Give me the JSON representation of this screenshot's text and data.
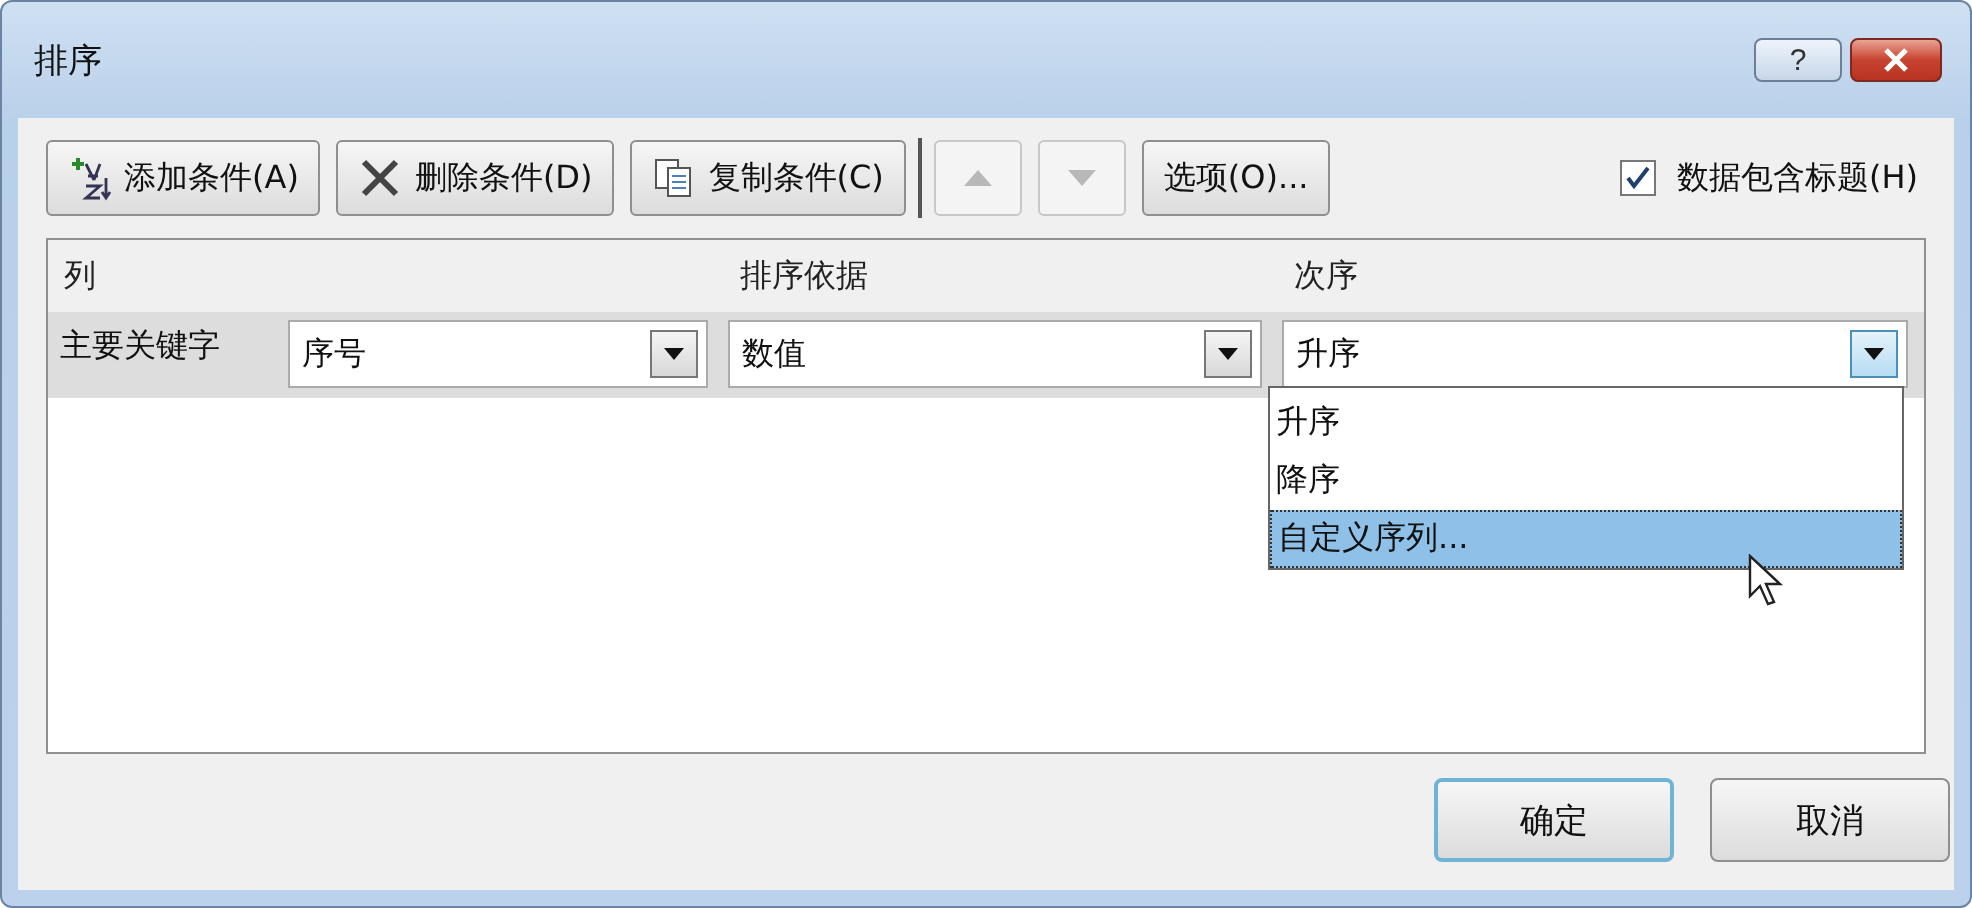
{
  "window": {
    "title": "排序",
    "help": "?"
  },
  "toolbar": {
    "buttons": [
      {
        "kind": "add",
        "label": "添加条件(A)",
        "disabled": false
      },
      {
        "kind": "delete",
        "label": "删除条件(D)",
        "disabled": false
      },
      {
        "kind": "copy",
        "label": "复制条件(C)",
        "disabled": false
      },
      {
        "kind": "up",
        "disabled": true
      },
      {
        "kind": "down",
        "disabled": true
      },
      {
        "kind": "text",
        "label": "选项(O)...",
        "disabled": false
      }
    ],
    "header_checkbox": {
      "label": "数据包含标题(H)",
      "checked": true
    }
  },
  "table": {
    "columns": [
      "列",
      "排序依据",
      "次序"
    ],
    "rows": [
      {
        "label": "主要关键字",
        "column": "序号",
        "sort_on": "数值",
        "order": "升序",
        "order_open": true
      }
    ]
  },
  "order_dropdown": {
    "options": [
      {
        "label": "升序",
        "selected": false
      },
      {
        "label": "降序",
        "selected": false
      },
      {
        "label": "自定义序列...",
        "selected": true
      }
    ]
  },
  "buttons": [
    {
      "label": "确定",
      "focused": true
    },
    {
      "label": "取消",
      "focused": false
    }
  ]
}
